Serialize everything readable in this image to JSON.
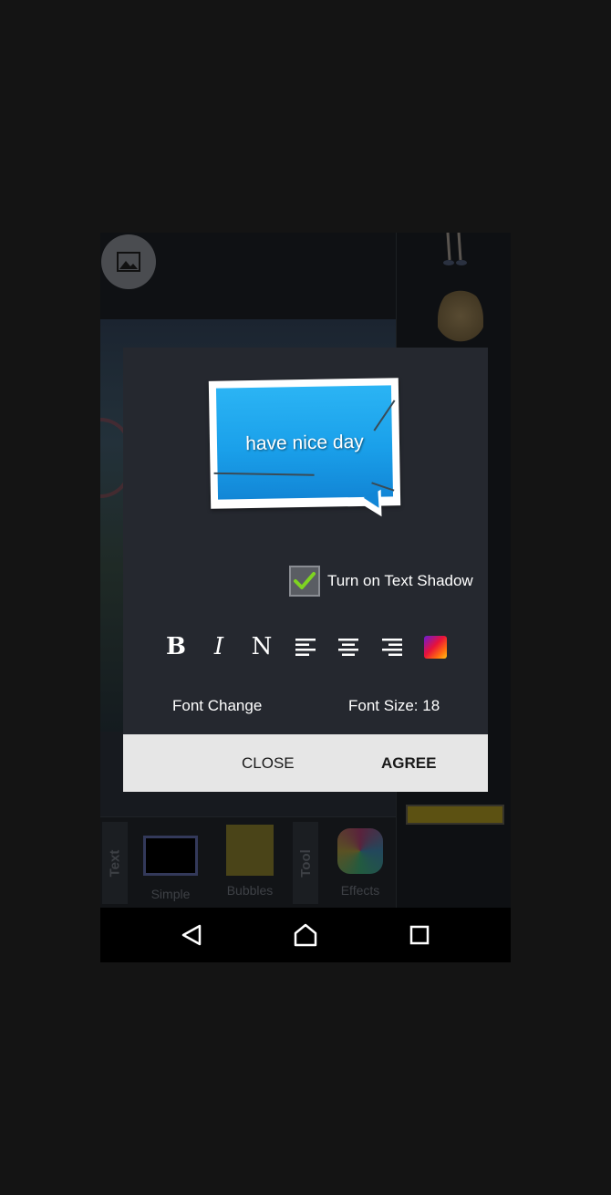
{
  "background_app": {
    "photo_button_icon": "image-icon",
    "bottom_tabs": {
      "text_tab_label": "Text",
      "tool_tab_label": "Tool",
      "items": [
        {
          "label": "Simple"
        },
        {
          "label": "Bubbles"
        },
        {
          "label": "Effects"
        }
      ]
    }
  },
  "dialog": {
    "preview_text": "have nice day",
    "text_shadow": {
      "label": "Turn on Text Shadow",
      "checked": true
    },
    "toolbar": {
      "bold_label": "B",
      "italic_label": "I",
      "normal_label": "N",
      "align_left_icon": "align-left-icon",
      "align_center_icon": "align-center-icon",
      "align_right_icon": "align-right-icon",
      "color_picker_icon": "color-picker-icon"
    },
    "font_change_label": "Font Change",
    "font_size_label": "Font Size: 18",
    "close_label": "CLOSE",
    "agree_label": "AGREE"
  },
  "navbar": {
    "back_icon": "back-icon",
    "home_icon": "home-icon",
    "recents_icon": "recents-icon"
  },
  "colors": {
    "dialog_bg": "#25282f",
    "button_bar_bg": "#e6e6e6",
    "bubble_blue": "#1aa0ea",
    "check_green": "#7ed321"
  }
}
